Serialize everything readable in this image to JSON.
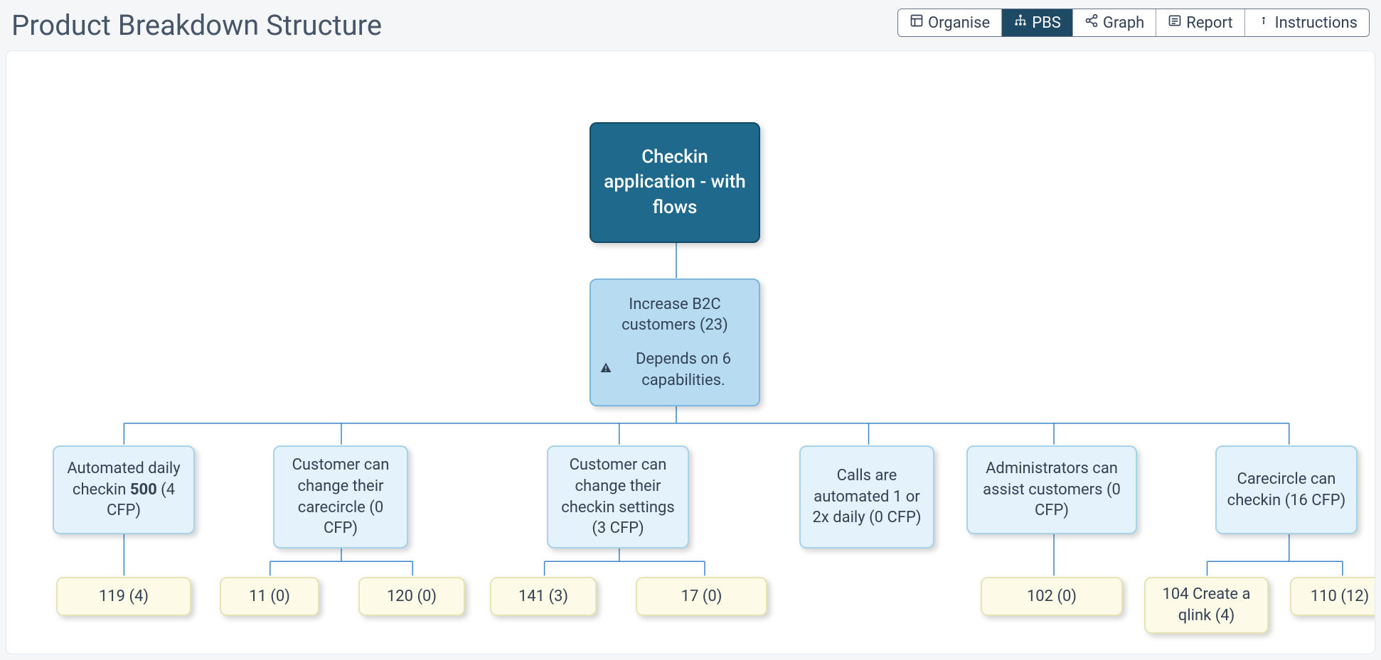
{
  "header": {
    "title": "Product Breakdown Structure",
    "tabs": [
      {
        "id": "organise",
        "label": "Organise",
        "icon": "layout"
      },
      {
        "id": "pbs",
        "label": "PBS",
        "icon": "sitemap",
        "active": true
      },
      {
        "id": "graph",
        "label": "Graph",
        "icon": "share"
      },
      {
        "id": "report",
        "label": "Report",
        "icon": "list"
      },
      {
        "id": "instructions",
        "label": "Instructions",
        "icon": "info"
      }
    ]
  },
  "nodes": {
    "root": {
      "label": "Checkin application - with flows"
    },
    "goal": {
      "label": "Increase B2C customers (23)",
      "warning": "Depends on 6 capabilities."
    },
    "caps": [
      {
        "id": "cap1",
        "prefix": "Automated daily checkin ",
        "bold": "500",
        "suffix": "  (4 CFP)"
      },
      {
        "id": "cap2",
        "label": "Customer can change their carecircle (0 CFP)"
      },
      {
        "id": "cap3",
        "label": "Customer can change their checkin settings (3 CFP)"
      },
      {
        "id": "cap4",
        "label": "Calls are automated 1 or 2x daily (0 CFP)"
      },
      {
        "id": "cap5",
        "label": "Administrators can assist customers (0 CFP)"
      },
      {
        "id": "cap6",
        "label": "Carecircle can checkin (16 CFP)"
      }
    ],
    "leaves": [
      {
        "id": "l119",
        "label": "119 (4)"
      },
      {
        "id": "l11",
        "label": "11 (0)"
      },
      {
        "id": "l120",
        "label": "120 (0)"
      },
      {
        "id": "l141",
        "label": "141 (3)"
      },
      {
        "id": "l17",
        "label": "17 (0)"
      },
      {
        "id": "l102",
        "label": "102 (0)"
      },
      {
        "id": "l104",
        "label": "104 Create a qlink (4)"
      },
      {
        "id": "l110",
        "label": "110 (12)"
      }
    ]
  }
}
